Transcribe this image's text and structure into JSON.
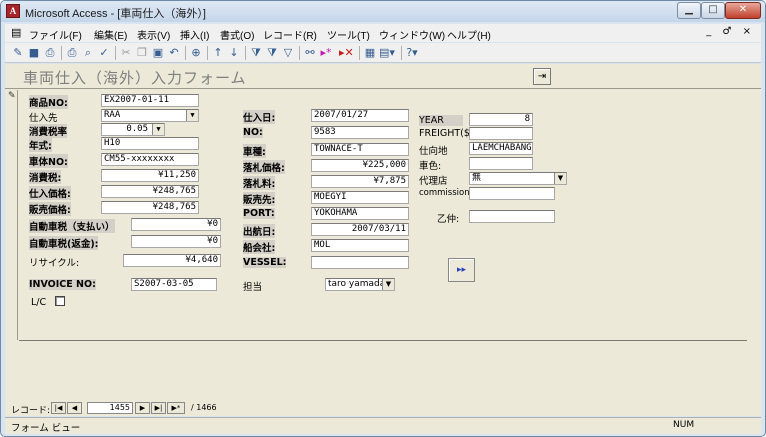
{
  "window": {
    "app_title": "Microsoft Access - [車両仕入（海外）]"
  },
  "menu": [
    "ファイル(F)",
    "編集(E)",
    "表示(V)",
    "挿入(I)",
    "書式(O)",
    "レコード(R)",
    "ツール(T)",
    "ウィンドウ(W)",
    "ヘルプ(H)"
  ],
  "mdi_controls": "_ ♂ ×",
  "form": {
    "title": "車両仕入（海外）入力フォーム",
    "left": {
      "product_no": {
        "label": "商品NO:",
        "value": "EX2007-01-11"
      },
      "supplier": {
        "label": "仕入先",
        "value": "RAA"
      },
      "tax_rate": {
        "label": "消費税率",
        "value": "0.05"
      },
      "model_year": {
        "label": "年式:",
        "value": "H10"
      },
      "chassis_no": {
        "label": "車体NO:",
        "value": "CM55-xxxxxxxx"
      },
      "consumption_tax": {
        "label": "消費税:",
        "value": "¥11,250"
      },
      "purchase_price": {
        "label": "仕入価格:",
        "value": "¥248,765"
      },
      "sale_price": {
        "label": "販売価格:",
        "value": "¥248,765"
      },
      "auto_tax_paid": {
        "label": "自動車税（支払い）",
        "value": "¥0"
      },
      "auto_tax_refund": {
        "label": "自動車税(返金):",
        "value": "¥0"
      },
      "recycle": {
        "label": "リサイクル:",
        "value": "¥4,640"
      },
      "invoice_no": {
        "label": "INVOICE NO:",
        "value": "S2007-03-05"
      },
      "lc": {
        "label": "L/C"
      }
    },
    "middle": {
      "purchase_date": {
        "label": "仕入日:",
        "value": "2007/01/27"
      },
      "no": {
        "label": "NO:",
        "value": "9583"
      },
      "vehicle_type": {
        "label": "車種:",
        "value": "TOWNACE-T"
      },
      "auction_price": {
        "label": "落札価格:",
        "value": "¥225,000"
      },
      "auction_fee": {
        "label": "落札料:",
        "value": "¥7,875"
      },
      "buyer": {
        "label": "販売先:",
        "value": "MOEGYI"
      },
      "port": {
        "label": "PORT:",
        "value": "YOKOHAMA"
      },
      "departure_date": {
        "label": "出航日:",
        "value": "2007/03/11"
      },
      "shipping_company": {
        "label": "船会社:",
        "value": "MOL"
      },
      "vessel": {
        "label": "VESSEL:",
        "value": ""
      },
      "staff": {
        "label": "担当",
        "value": "taro yamada"
      }
    },
    "right": {
      "year": {
        "label": "YEAR",
        "value": "8"
      },
      "freight": {
        "label": "FREIGHT($):",
        "value": ""
      },
      "destination": {
        "label": "仕向地",
        "value": "LAEMCHABANG"
      },
      "color": {
        "label": "車色:",
        "value": ""
      },
      "agent": {
        "label": "代理店",
        "value": "無"
      },
      "commission": {
        "label": "commission:",
        "value": ""
      },
      "otsu": {
        "label": "乙仲:",
        "value": ""
      }
    }
  },
  "navigation": {
    "label": "レコード:",
    "current": "1455",
    "total": "1466",
    "of_sep": "/"
  },
  "status": {
    "view": "フォーム ビュー",
    "num": "NUM"
  }
}
